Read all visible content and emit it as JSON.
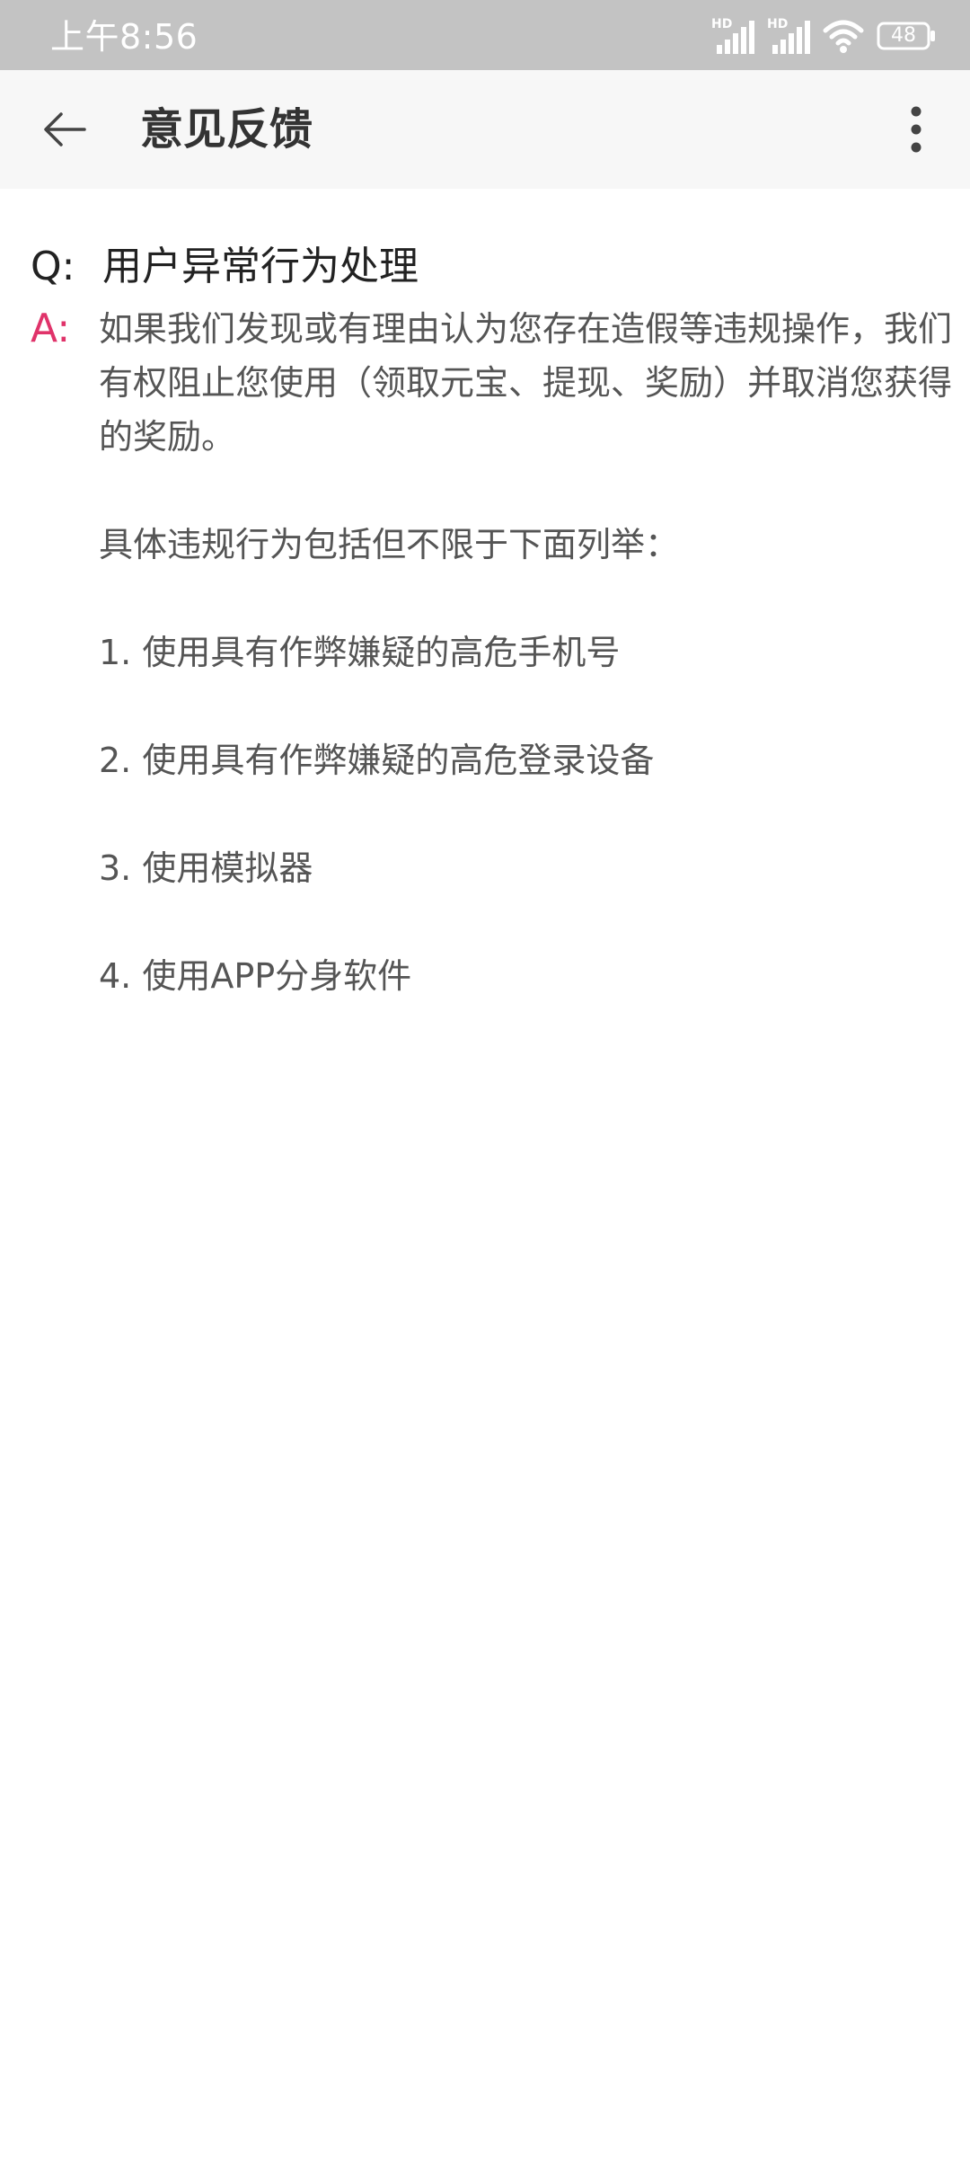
{
  "status_bar": {
    "time": "上午8:56",
    "signal_label_1": "HD",
    "signal_label_2": "HD",
    "battery": "48"
  },
  "app_bar": {
    "title": "意见反馈"
  },
  "faq": {
    "q_label": "Q:",
    "question": "用户异常行为处理",
    "a_label": "A:",
    "answer": [
      "如果我们发现或有理由认为您存在造假等违规操作，我们有权阻止您使用（领取元宝、提现、奖励）并取消您获得的奖励。",
      "具体违规行为包括但不限于下面列举：",
      "1. 使用具有作弊嫌疑的高危手机号",
      "2.  使用具有作弊嫌疑的高危登录设备",
      "3. 使用模拟器",
      "4. 使用APP分身软件"
    ]
  },
  "colors": {
    "status_bar_bg": "#c3c3c3",
    "app_bar_bg": "#f7f7f7",
    "answer_label": "#e0336a",
    "answer_text": "#555555"
  }
}
